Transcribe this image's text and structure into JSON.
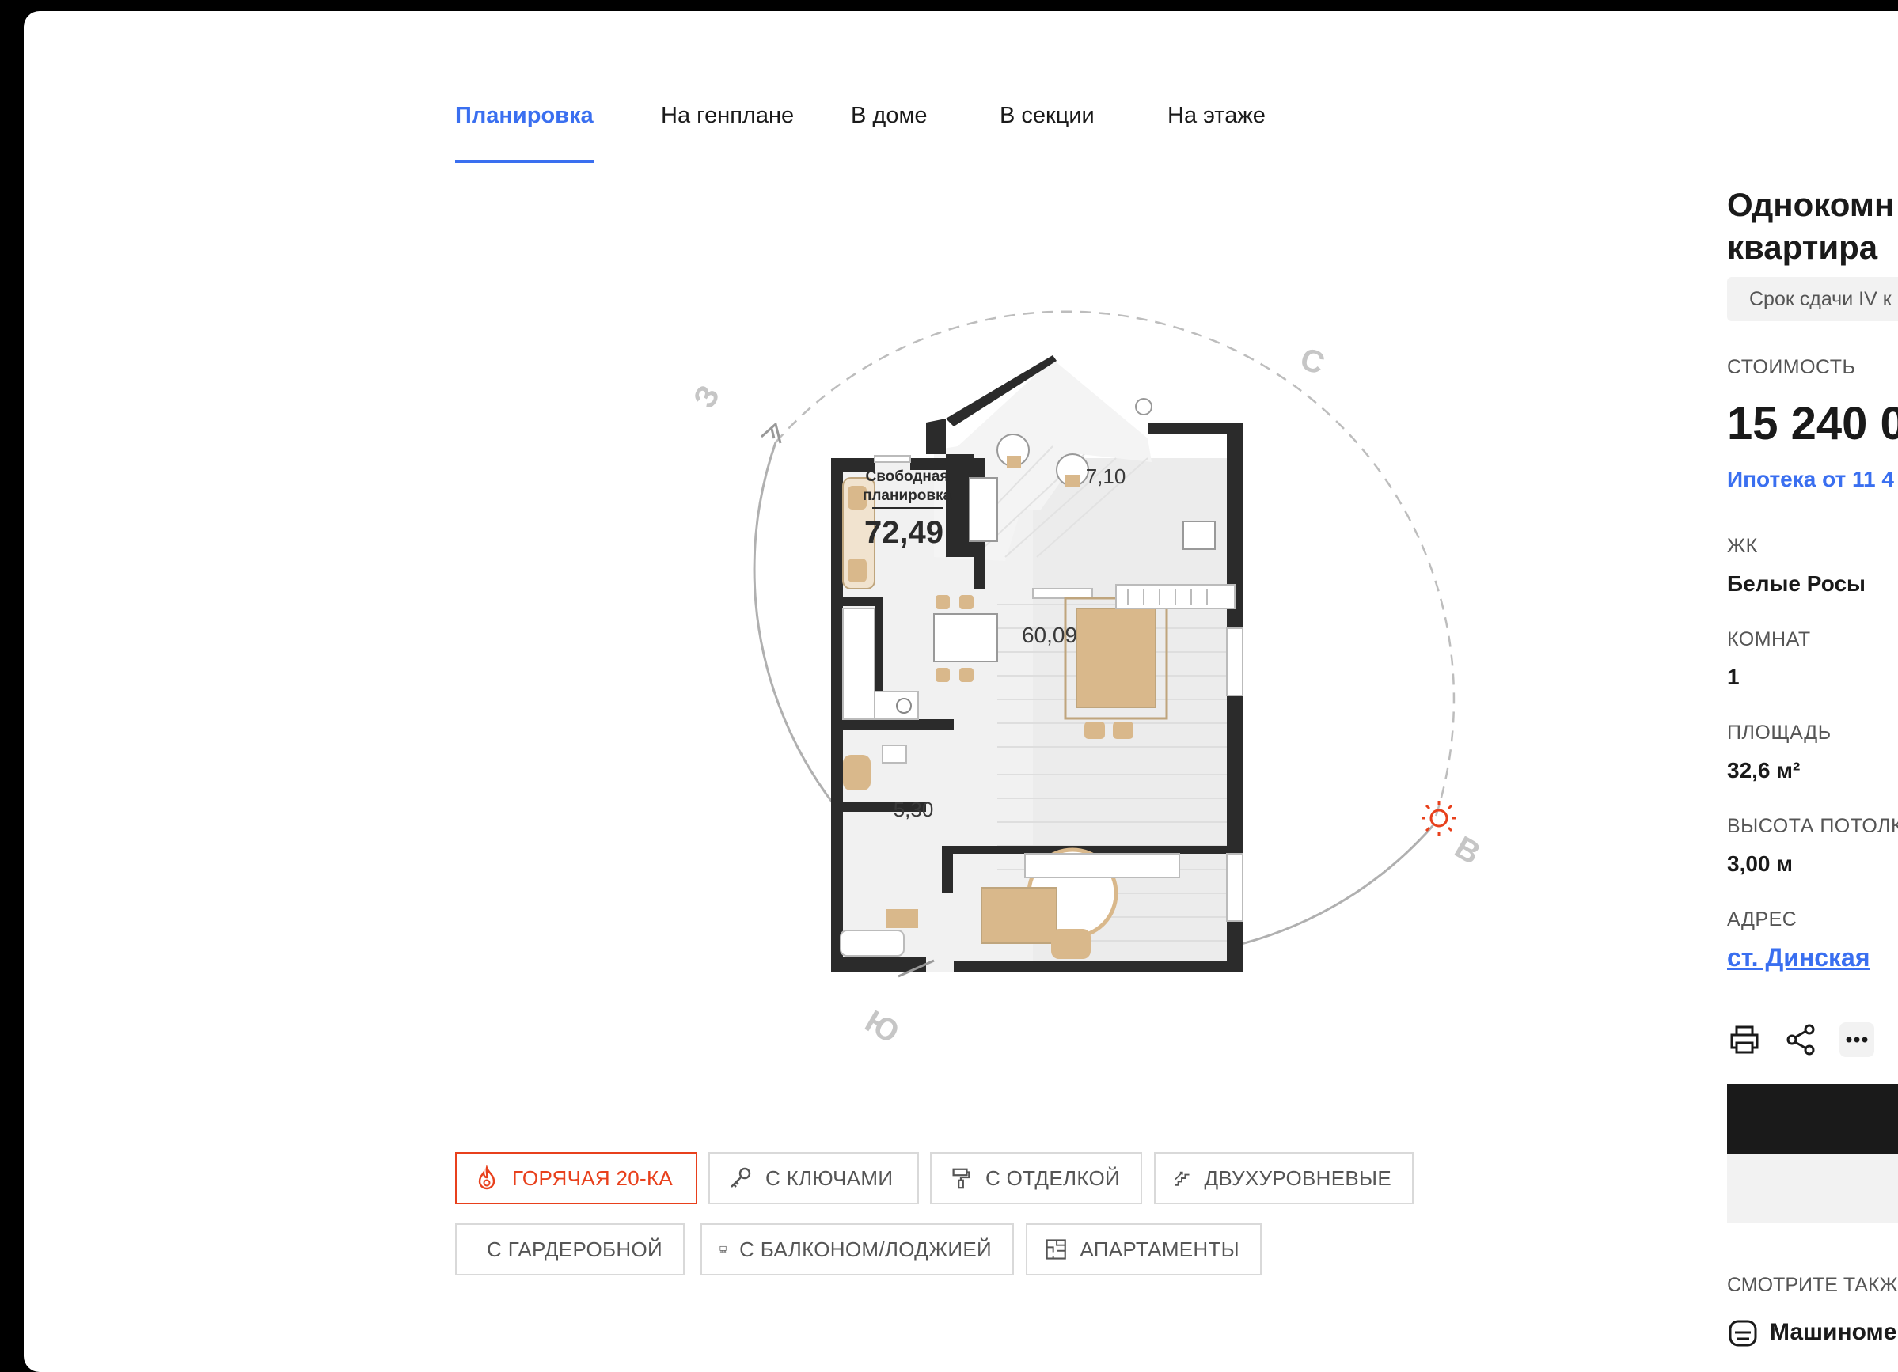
{
  "tabs": [
    {
      "label": "Планировка",
      "active": true
    },
    {
      "label": "На генплане",
      "active": false
    },
    {
      "label": "В доме",
      "active": false
    },
    {
      "label": "В секции",
      "active": false
    },
    {
      "label": "На этаже",
      "active": false
    }
  ],
  "plan": {
    "free_layout": "Свободная планировка",
    "free_layout_line1": "Свободная",
    "free_layout_line2": "планировка",
    "total_area": "72,49",
    "living_area": "60,09",
    "balcony_area": "7,10",
    "bathroom_area": "5,30",
    "compass": {
      "north": "С",
      "west": "З",
      "east": "В",
      "south": "Ю"
    }
  },
  "tags": [
    {
      "label": "ГОРЯЧАЯ 20-КА",
      "icon": "flame-icon",
      "hot": true
    },
    {
      "label": "С КЛЮЧАМИ",
      "icon": "key-icon",
      "hot": false
    },
    {
      "label": "С ОТДЕЛКОЙ",
      "icon": "paint-roller-icon",
      "hot": false
    },
    {
      "label": "ДВУХУРОВНЕВЫЕ",
      "icon": "stairs-icon",
      "hot": false
    },
    {
      "label": "С ГАРДЕРОБНОЙ",
      "icon": "wardrobe-icon",
      "hot": false
    },
    {
      "label": "С БАЛКОНОМ/ЛОДЖИЕЙ",
      "icon": "balcony-icon",
      "hot": false
    },
    {
      "label": "АПАРТАМЕНТЫ",
      "icon": "floorplan-icon",
      "hot": false
    }
  ],
  "info": {
    "title_line1": "Однокомн",
    "title_line2": "квартира",
    "deadline": "Срок сдачи IV к",
    "price_label": "СТОИМОСТЬ",
    "price": "15 240 0",
    "mortgage": "Ипотека от 11 4",
    "complex_label": "ЖК",
    "complex": "Белые Росы",
    "rooms_label": "КОМНАТ",
    "rooms": "1",
    "area_label": "ПЛОЩАДЬ",
    "area": "32,6 м²",
    "ceiling_label": "ВЫСОТА ПОТОЛК",
    "ceiling": "3,00 м",
    "address_label": "АДРЕС",
    "address": "ст. Динская",
    "see_also": "СМОТРИТЕ ТАКЖЕ",
    "parking": "Машиноме"
  },
  "colors": {
    "accent": "#3a6ff0",
    "hot": "#e8401c",
    "furniture": "#d9b88b"
  }
}
